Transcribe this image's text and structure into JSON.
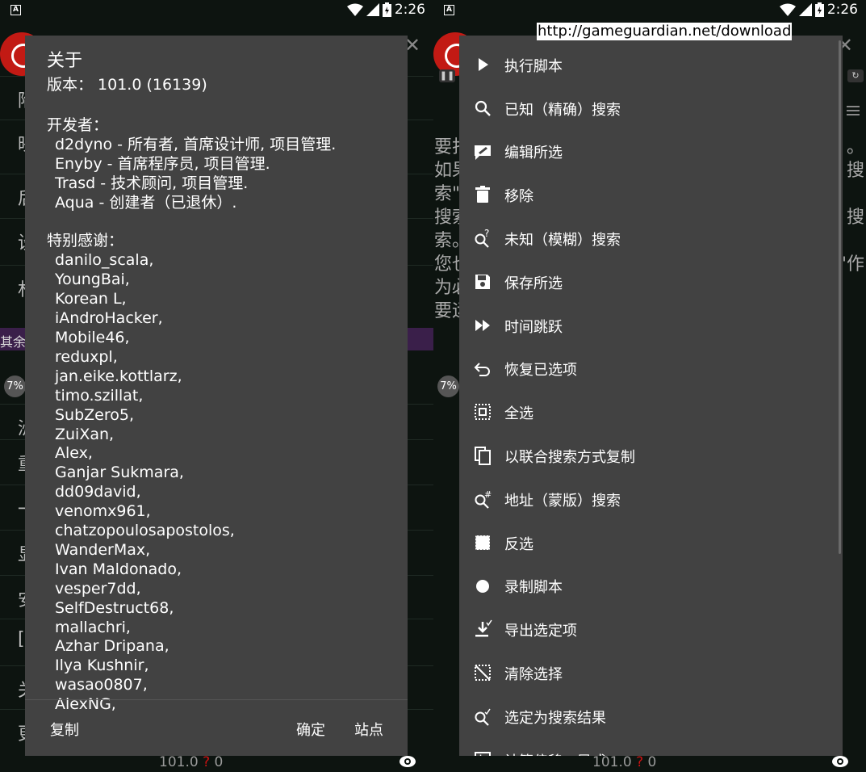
{
  "status": {
    "time": "2:26",
    "notif_letter": "A"
  },
  "left": {
    "about": {
      "title": "关于",
      "version_line": "版本： 101.0 (16139)",
      "developers_header": "开发者：",
      "developers": [
        "d2dyno - 所有者, 首席设计师, 项目管理.",
        "Enyby - 首席程序员, 项目管理.",
        "Trasd - 技术顾问, 项目管理.",
        "Aqua - 创建者（已退休）."
      ],
      "thanks_header": "特别感谢：",
      "thanks": [
        "danilo_scala,",
        "YoungBai,",
        "Korean L,",
        "iAndroHacker,",
        "Mobile46,",
        "reduxpl,",
        "jan.eike.kottlarz,",
        "timo.szillat,",
        "SubZero5,",
        "ZuiXan,",
        "Alex,",
        "Ganjar Sukmara,",
        "dd09david,",
        "venomx961,",
        "chatzopoulosapostolos,",
        "WanderMax,",
        "Ivan Maldonado,",
        "vesper7dd,",
        "SelfDestruct68,",
        "mallachri,",
        "Azhar Dripana,",
        "Ilya Kushnir,",
        "wasao0807,",
        "AlexNG,"
      ],
      "buttons": {
        "copy": "复制",
        "ok": "确定",
        "site": "站点"
      }
    },
    "bg_rows": [
      "陷",
      "映",
      "后",
      "设",
      "林",
      "其余",
      "洲",
      "重",
      "一",
      "显",
      "安",
      "[]",
      "关",
      "更"
    ]
  },
  "right": {
    "url": "http://gameguardian.net/download",
    "bg_text": [
      {
        "l": "要打",
        "r": "。"
      },
      {
        "l": "如果",
        "r": "搜"
      },
      {
        "l": "索\"",
        "r": ""
      },
      {
        "l": "搜索",
        "r": "搜"
      },
      {
        "l": "索。",
        "r": ""
      },
      {
        "l": "您也",
        "r": "\"作"
      },
      {
        "l": "为必",
        "r": ""
      },
      {
        "l": "要运",
        "r": ""
      }
    ],
    "menu": [
      {
        "label": "执行脚本",
        "icon": "play-icon"
      },
      {
        "label": "已知（精确）搜索",
        "icon": "search-icon"
      },
      {
        "label": "编辑所选",
        "icon": "edit-comment-icon"
      },
      {
        "label": "移除",
        "icon": "trash-icon"
      },
      {
        "label": "未知（模糊）搜索",
        "icon": "fuzzy-search-icon"
      },
      {
        "label": "保存所选",
        "icon": "save-icon"
      },
      {
        "label": "时间跳跃",
        "icon": "fast-forward-icon"
      },
      {
        "label": "恢复已选项",
        "icon": "undo-icon"
      },
      {
        "label": "全选",
        "icon": "select-all-icon"
      },
      {
        "label": "以联合搜索方式复制",
        "icon": "copy-icon"
      },
      {
        "label": "地址（蒙版）搜索",
        "icon": "address-search-icon"
      },
      {
        "label": "反选",
        "icon": "invert-selection-icon"
      },
      {
        "label": "录制脚本",
        "icon": "record-icon"
      },
      {
        "label": "导出选定项",
        "icon": "export-icon"
      },
      {
        "label": "清除选择",
        "icon": "clear-selection-icon"
      },
      {
        "label": "选定为搜索结果",
        "icon": "select-as-results-icon"
      },
      {
        "label": "计算偏移 - 异或",
        "icon": "calculator-icon"
      }
    ]
  },
  "shared": {
    "badge": "7%",
    "version": "101.0",
    "version_mark": "?",
    "version_count": "0"
  }
}
